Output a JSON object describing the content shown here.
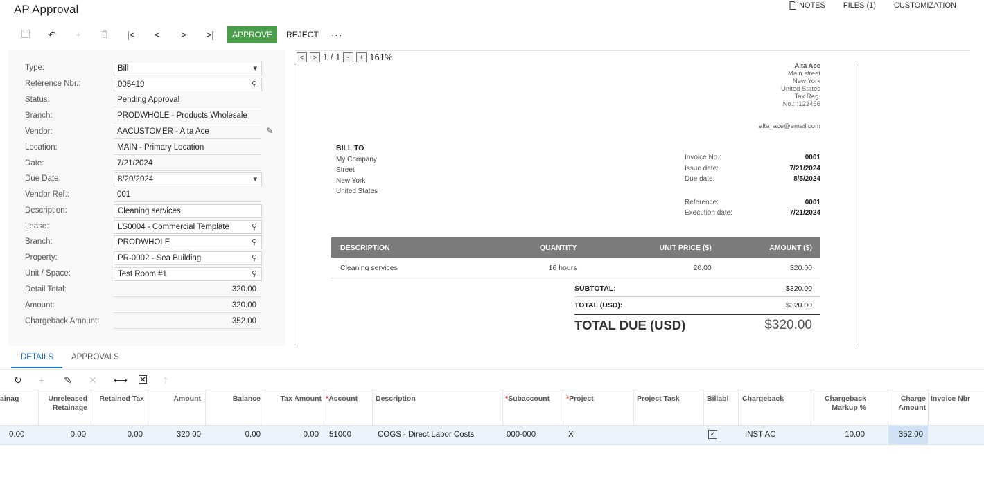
{
  "page": {
    "title": "AP Approval"
  },
  "top_links": {
    "notes": "NOTES",
    "files": "FILES (1)",
    "customization": "CUSTOMIZATION"
  },
  "toolbar": {
    "approve": "APPROVE",
    "reject": "REJECT",
    "more": "···"
  },
  "form": [
    {
      "label": "Type:",
      "value": "Bill",
      "icon": "chevron-down"
    },
    {
      "label": "Reference Nbr.:",
      "value": "005419",
      "icon": "search"
    },
    {
      "label": "Status:",
      "value": "Pending Approval"
    },
    {
      "label": "Branch:",
      "value": "PRODWHOLE - Products Wholesale"
    },
    {
      "label": "Vendor:",
      "value": "AACUSTOMER - Alta Ace",
      "icon": "pencil"
    },
    {
      "label": "Location:",
      "value": "MAIN - Primary Location"
    },
    {
      "label": "Date:",
      "value": "7/21/2024"
    },
    {
      "label": "Due Date:",
      "value": "8/20/2024",
      "icon": "chevron-down"
    },
    {
      "label": "Vendor Ref.:",
      "value": "001"
    },
    {
      "label": "Description:",
      "value": "Cleaning services"
    },
    {
      "label": "Lease:",
      "value": "LS0004 - Commercial Template",
      "icon": "search"
    },
    {
      "label": "Branch:",
      "value": "PRODWHOLE",
      "icon": "search"
    },
    {
      "label": "Property:",
      "value": "PR-0002 - Sea Building",
      "icon": "search"
    },
    {
      "label": "Unit / Space:",
      "value": "Test Room #1",
      "icon": "search"
    },
    {
      "label": "Detail Total:",
      "value": "320.00"
    },
    {
      "label": "Amount:",
      "value": "320.00"
    },
    {
      "label": "Chargeback Amount:",
      "value": "352.00"
    }
  ],
  "viewer": {
    "prev": "<",
    "next": ">",
    "page": "1 / 1",
    "zoom_out": "-",
    "zoom_in": "+",
    "zoom": "161%"
  },
  "invoice": {
    "company_lines": [
      "Alta Ace",
      "Main street",
      "New York",
      "United States",
      "Tax Reg.",
      "No.: :123456"
    ],
    "email": "alta_ace@email.com",
    "bill_to_label": "BILL TO",
    "bill_to_lines": [
      "My Company",
      "Street",
      "New York",
      "United States"
    ],
    "meta": [
      {
        "label": "Invoice No.:",
        "value": "0001"
      },
      {
        "label": "Issue date:",
        "value": "7/21/2024"
      },
      {
        "label": "Due date:",
        "value": "8/5/2024"
      },
      {
        "label": "",
        "value": ""
      },
      {
        "label": "Reference:",
        "value": "0001"
      },
      {
        "label": "Execution date:",
        "value": "7/21/2024"
      }
    ],
    "columns": [
      "DESCRIPTION",
      "QUANTITY",
      "UNIT PRICE ($)",
      "AMOUNT ($)"
    ],
    "row": {
      "description": "Cleaning services",
      "quantity": "16 hours",
      "unit_price": "20.00",
      "amount": "320.00"
    },
    "subtotal_label": "SUBTOTAL:",
    "subtotal": "$320.00",
    "total_label": "TOTAL (USD):",
    "total": "$320.00",
    "due_label": "TOTAL DUE (USD)",
    "due": "$320.00"
  },
  "tabs": {
    "details": "DETAILS",
    "approvals": "APPROVALS"
  },
  "grid": {
    "columns": [
      {
        "label": "ainag",
        "required": false
      },
      {
        "label": "Unreleased Retainage",
        "required": false
      },
      {
        "label": "Retained Tax",
        "required": false
      },
      {
        "label": "Amount",
        "required": false
      },
      {
        "label": "Balance",
        "required": false
      },
      {
        "label": "Tax Amount",
        "required": false
      },
      {
        "label": "Account",
        "required": true
      },
      {
        "label": "Description",
        "required": false
      },
      {
        "label": "Subaccount",
        "required": true
      },
      {
        "label": "Project",
        "required": true
      },
      {
        "label": "Project Task",
        "required": false
      },
      {
        "label": "Billabl",
        "required": false
      },
      {
        "label": "Chargeback",
        "required": false
      },
      {
        "label": "Chargeback Markup %",
        "required": false
      },
      {
        "label": "Charge Amount",
        "required": false
      },
      {
        "label": "Invoice Nbr",
        "required": false
      }
    ],
    "row": {
      "retainage": "0.00",
      "unreleased": "0.00",
      "retained_tax": "0.00",
      "amount": "320.00",
      "balance": "0.00",
      "tax_amount": "0.00",
      "account": "51000",
      "description": "COGS - Direct Labor Costs",
      "subaccount": "000-000",
      "project": "X",
      "project_task": "",
      "billable": true,
      "chargeback": "INST AC",
      "markup": "10.00",
      "charge_amount": "352.00",
      "invoice_nbr": ""
    }
  }
}
